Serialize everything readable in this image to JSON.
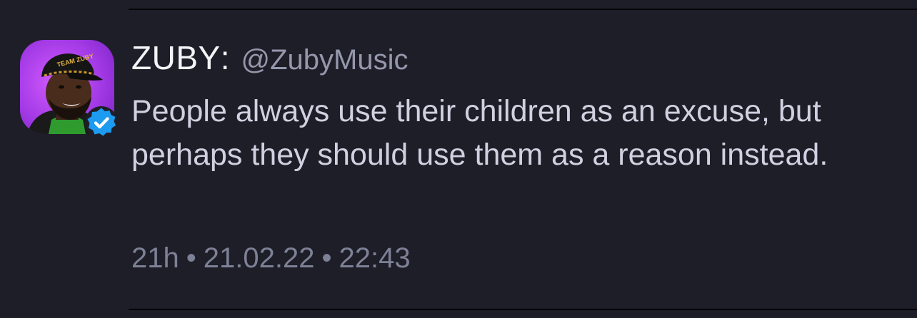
{
  "tweet": {
    "display_name": "ZUBY",
    "name_separator": ":",
    "handle": "@ZubyMusic",
    "verified": true,
    "text": "People always use their children as an excuse, but perhaps they should use them as a reason instead.",
    "relative_time": "21h",
    "date": "21.02.22",
    "time": "22:43",
    "meta_separator": "•",
    "avatar_cap_text": "TEAM ZUBY"
  },
  "colors": {
    "background": "#1e1e28",
    "name": "#f4f4f8",
    "handle": "#9598ac",
    "body_text": "#d0d1e0",
    "meta_text": "#7d8196",
    "verified_badge": "#1d9bf0",
    "avatar_background": "#a43be6"
  },
  "icons": {
    "verified": "verified-badge-icon",
    "avatar": "profile-photo"
  }
}
